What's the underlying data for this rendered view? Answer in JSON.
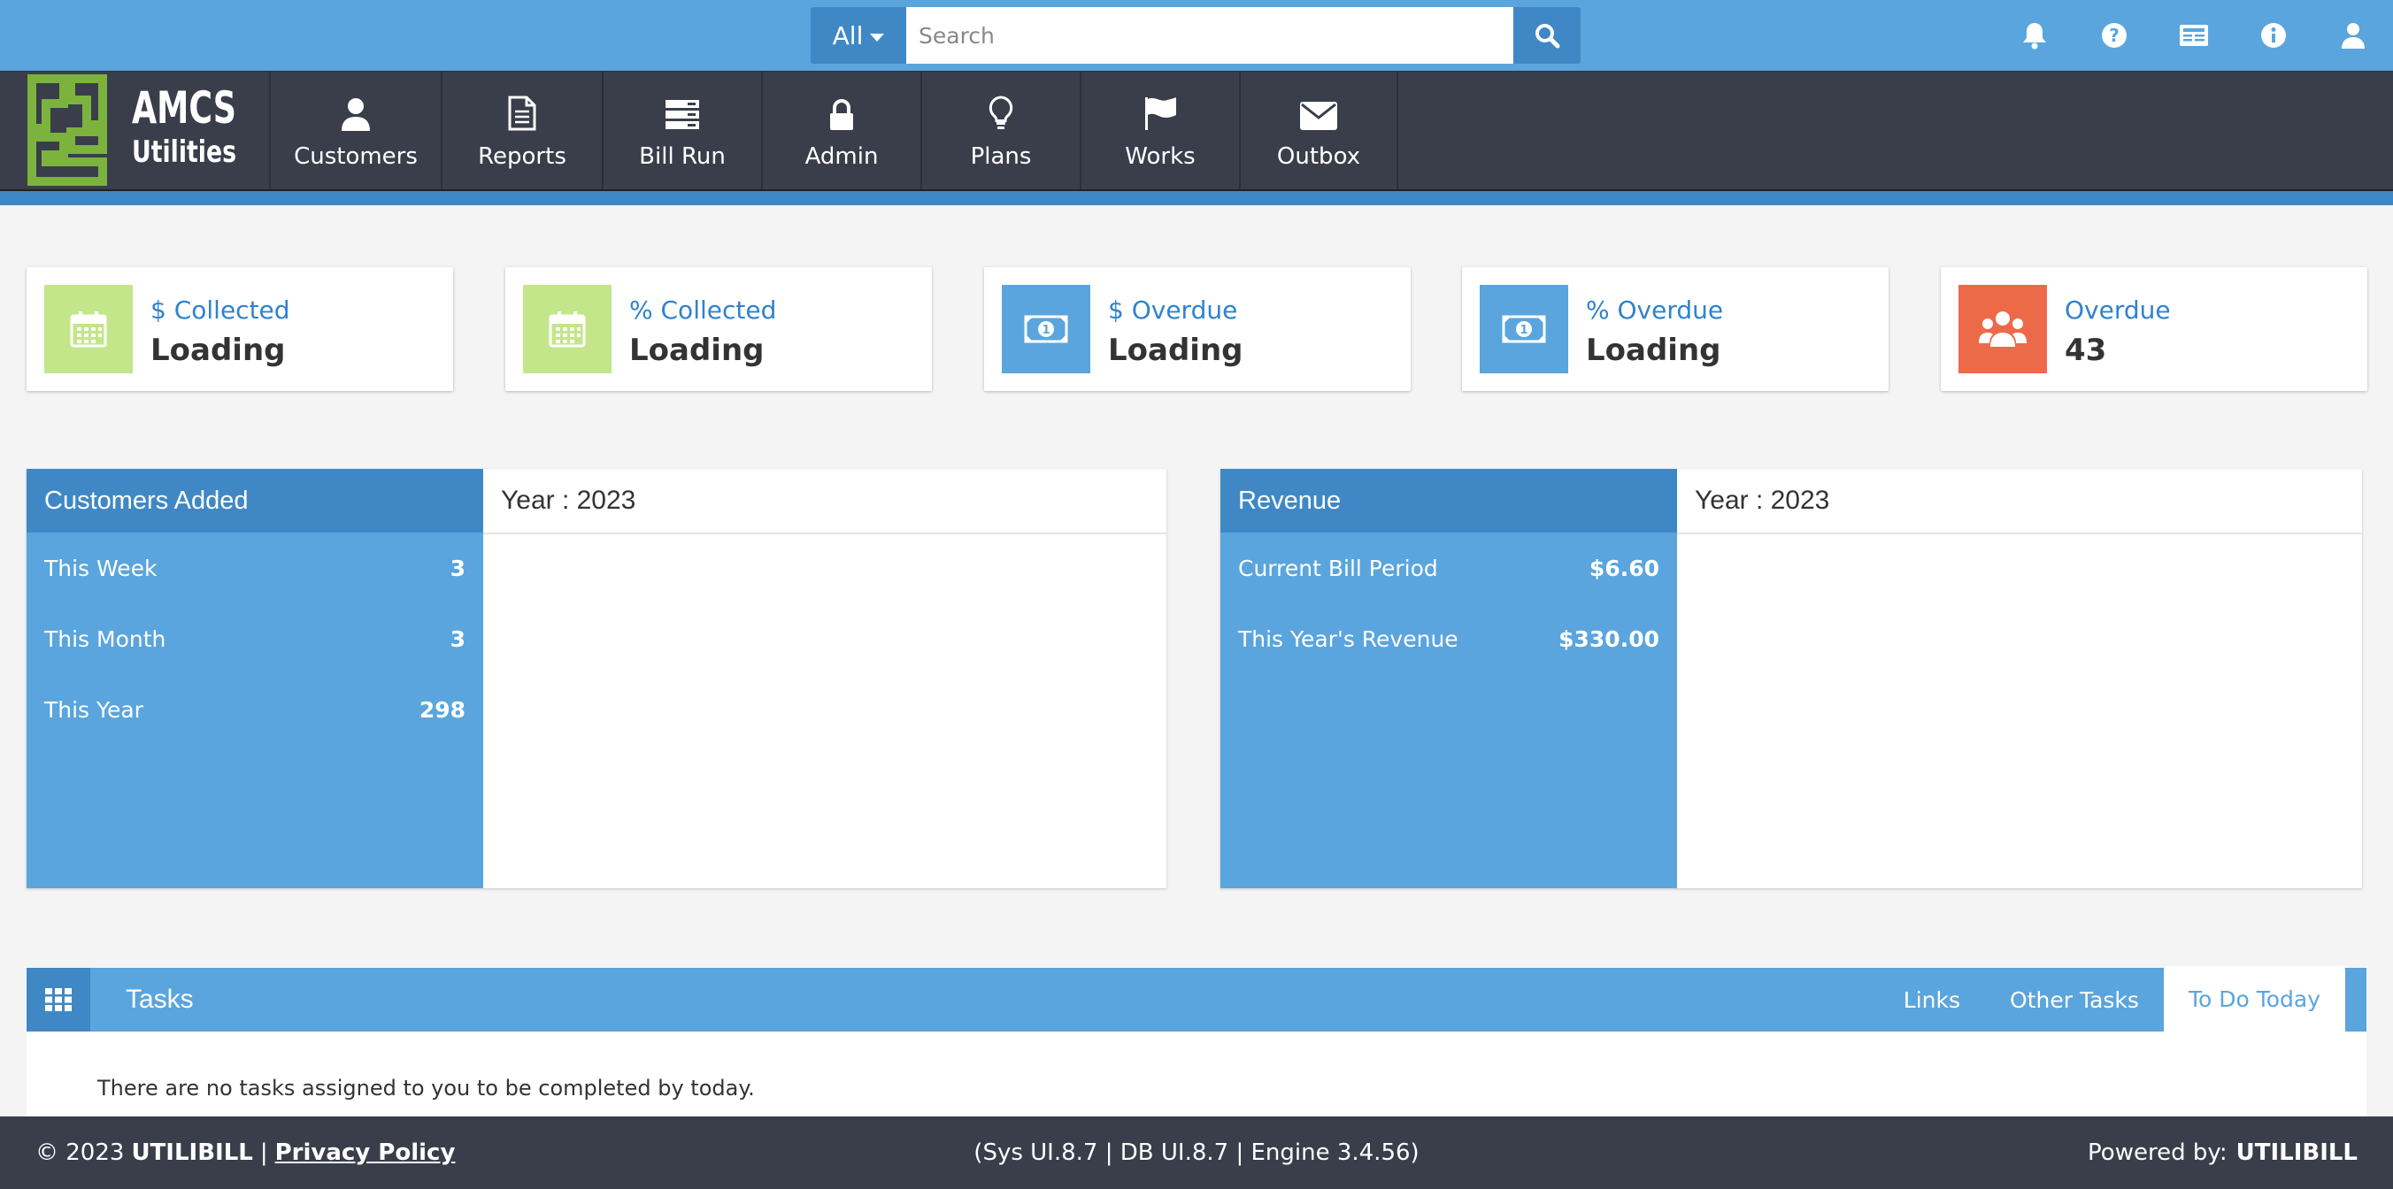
{
  "search": {
    "scope": "All",
    "placeholder": "Search",
    "value": ""
  },
  "top_icons": [
    "bell-icon",
    "help-icon",
    "news-icon",
    "info-icon",
    "user-icon"
  ],
  "logo": {
    "line1": "AMCS",
    "line2": "Utilities"
  },
  "nav": [
    {
      "label": "Customers",
      "icon": "user-icon"
    },
    {
      "label": "Reports",
      "icon": "document-icon"
    },
    {
      "label": "Bill Run",
      "icon": "server-icon"
    },
    {
      "label": "Admin",
      "icon": "lock-icon"
    },
    {
      "label": "Plans",
      "icon": "lightbulb-icon"
    },
    {
      "label": "Works",
      "icon": "flag-icon"
    },
    {
      "label": "Outbox",
      "icon": "envelope-icon"
    }
  ],
  "stats": [
    {
      "title": "$ Collected",
      "value": "Loading",
      "icon": "calendar-icon",
      "color": "#c3e68a"
    },
    {
      "title": "% Collected",
      "value": "Loading",
      "icon": "calendar-icon",
      "color": "#c3e68a"
    },
    {
      "title": "$ Overdue",
      "value": "Loading",
      "icon": "money-icon",
      "color": "#5aa5dd"
    },
    {
      "title": "% Overdue",
      "value": "Loading",
      "icon": "money-icon",
      "color": "#5aa5dd"
    },
    {
      "title": "Overdue",
      "value": "43",
      "icon": "users-icon",
      "color": "#ec6a48"
    }
  ],
  "customers_panel": {
    "title": "Customers Added",
    "year_label": "Year : 2023",
    "rows": [
      {
        "label": "This Week",
        "value": "3"
      },
      {
        "label": "This Month",
        "value": "3"
      },
      {
        "label": "This Year",
        "value": "298"
      }
    ]
  },
  "revenue_panel": {
    "title": "Revenue",
    "year_label": "Year : 2023",
    "rows": [
      {
        "label": "Current Bill Period",
        "value": "$6.60"
      },
      {
        "label": "This Year's Revenue",
        "value": "$330.00"
      }
    ]
  },
  "tasks": {
    "title": "Tasks",
    "tabs": [
      {
        "label": "Links",
        "active": false
      },
      {
        "label": "Other Tasks",
        "active": false
      },
      {
        "label": "To Do Today",
        "active": true
      }
    ],
    "message": "There are no tasks assigned to you to be completed by today."
  },
  "footer": {
    "copyright": "© 2023",
    "brand": "UTILIBILL",
    "separator": "|",
    "privacy": "Privacy Policy",
    "version": "(Sys UI.8.7 | DB UI.8.7 | Engine 3.4.56)",
    "powered_label": "Powered by:",
    "powered_brand": "UTILIBILL"
  },
  "colors": {
    "accent": "#5aa5dd",
    "accent_dark": "#3f88c5",
    "nav_bg": "#393e4a",
    "green": "#c3e68a",
    "orange": "#ec6a48"
  }
}
